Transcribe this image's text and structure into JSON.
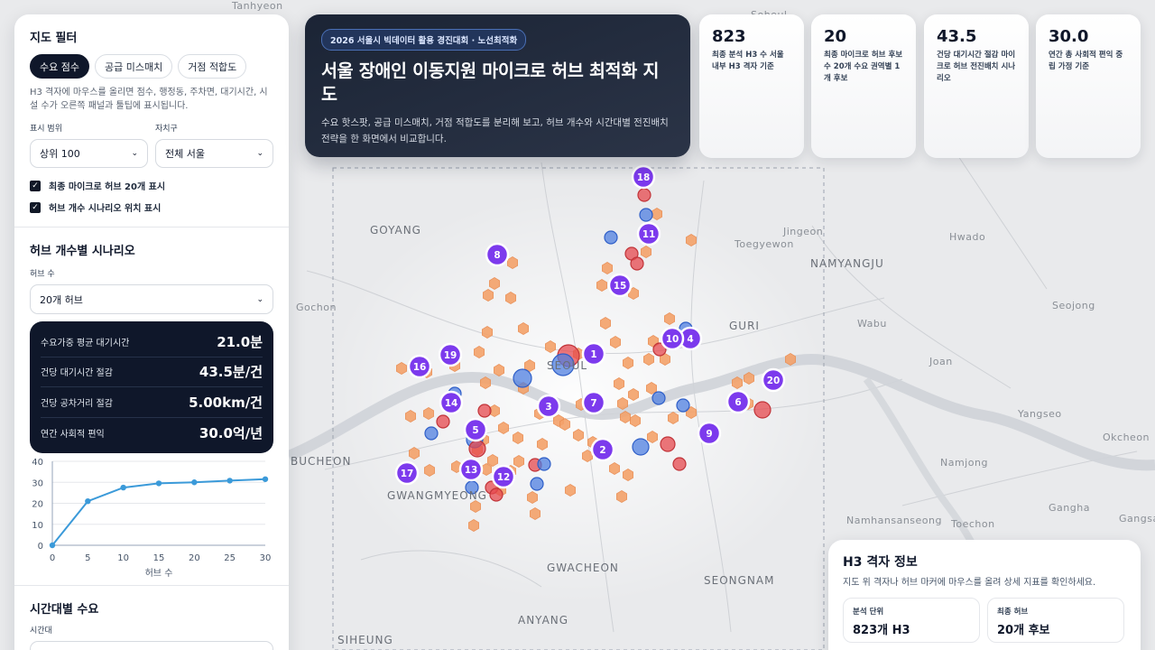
{
  "map": {
    "places": [
      {
        "name": "Tanhyeon"
      },
      {
        "name": "Soheul"
      },
      {
        "name": "Jingeon"
      },
      {
        "name": "Toegyewon"
      },
      {
        "name": "Hwado"
      },
      {
        "name": "NAMYANGJU"
      },
      {
        "name": "GOYANG"
      },
      {
        "name": "Gochon"
      },
      {
        "name": "Seojong"
      },
      {
        "name": "GURI"
      },
      {
        "name": "Wabu"
      },
      {
        "name": "Joan"
      },
      {
        "name": "Yangseo"
      },
      {
        "name": "Okcheon"
      },
      {
        "name": "BUCHEON"
      },
      {
        "name": "Namjong"
      },
      {
        "name": "GWANGMYEONG"
      },
      {
        "name": "Gangha"
      },
      {
        "name": "Namhansanseong"
      },
      {
        "name": "Toechon"
      },
      {
        "name": "Gangsang"
      },
      {
        "name": "GWACHEON"
      },
      {
        "name": "SEONGNAM"
      },
      {
        "name": "ANYANG"
      },
      {
        "name": "SIHEUNG"
      },
      {
        "name": "SEOUL"
      }
    ],
    "hubs": [
      "1",
      "2",
      "3",
      "4",
      "5",
      "6",
      "7",
      "8",
      "9",
      "10",
      "11",
      "12",
      "13",
      "14",
      "15",
      "16",
      "17",
      "18",
      "19",
      "20"
    ]
  },
  "filter": {
    "title": "지도 필터",
    "tabs": [
      {
        "label": "수요 점수",
        "active": true
      },
      {
        "label": "공급 미스매치",
        "active": false
      },
      {
        "label": "거점 적합도",
        "active": false
      }
    ],
    "hint": "H3 격자에 마우스를 올리면 점수, 행정동, 주차면, 대기시간, 시설 수가 오른쪽 패널과 툴팁에 표시됩니다.",
    "range_label": "표시 범위",
    "range_value": "상위 100",
    "district_label": "자치구",
    "district_value": "전체 서울",
    "check1": "최종 마이크로 허브 20개 표시",
    "check2": "허브 개수 시나리오 위치 표시"
  },
  "scenario": {
    "title": "허브 개수별 시나리오",
    "hub_count_label": "허브 수",
    "hub_count_value": "20개 허브",
    "metrics": [
      {
        "label": "수요가중 평균 대기시간",
        "value": "21.0분"
      },
      {
        "label": "건당 대기시간 절감",
        "value": "43.5분/건"
      },
      {
        "label": "건당 공차거리 절감",
        "value": "5.00km/건"
      },
      {
        "label": "연간 사회적 편익",
        "value": "30.0억/년"
      }
    ]
  },
  "chart_data": {
    "type": "line",
    "x": [
      0,
      5,
      10,
      15,
      20,
      25,
      30
    ],
    "y": [
      0,
      21,
      27.5,
      29.5,
      30,
      30.8,
      31.5
    ],
    "xlabel": "허브 수",
    "ylabel": "",
    "xticks": [
      0,
      5,
      10,
      15,
      20,
      25,
      30
    ],
    "yticks": [
      0,
      10,
      20,
      30,
      40
    ],
    "ylim": [
      0,
      40
    ],
    "xlim": [
      0,
      30
    ],
    "color": "#3b9ad9",
    "grid": true
  },
  "time": {
    "title": "시간대별 수요",
    "label": "시간대"
  },
  "hero": {
    "badge": "2026 서울시 빅데이터 활용 경진대회 · 노선최적화",
    "title": "서울 장애인 이동지원 마이크로 허브 최적화 지도",
    "desc": "수요 핫스팟, 공급 미스매치, 거점 적합도를 분리해 보고, 허브 개수와 시간대별 전진배치 전략을 한 화면에서 비교합니다."
  },
  "stats": [
    {
      "value": "823",
      "label": "최종 분석 H3 수 서울 내부 H3 격자 기준"
    },
    {
      "value": "20",
      "label": "최종 마이크로 허브 후보 수 20개 수요 권역별 1개 후보"
    },
    {
      "value": "43.5",
      "label": "건당 대기시간 절감 마이크로 허브 전진배치 시나리오"
    },
    {
      "value": "30.0",
      "label": "연간 총 사회적 편익 중립 가정 기준"
    }
  ],
  "info": {
    "title": "H3 격자 정보",
    "hint": "지도 위 격자나 허브 마커에 마우스를 올려 상세 지표를 확인하세요.",
    "cards": [
      {
        "label": "분석 단위",
        "value": "823개 H3"
      },
      {
        "label": "최종 허브",
        "value": "20개 후보"
      }
    ]
  },
  "colors": {
    "hub": "#7c3aed",
    "hex": "#f4a26a",
    "red": "#e5484d",
    "blue": "#4f7fe0",
    "panel_dark": "#0f172a"
  }
}
